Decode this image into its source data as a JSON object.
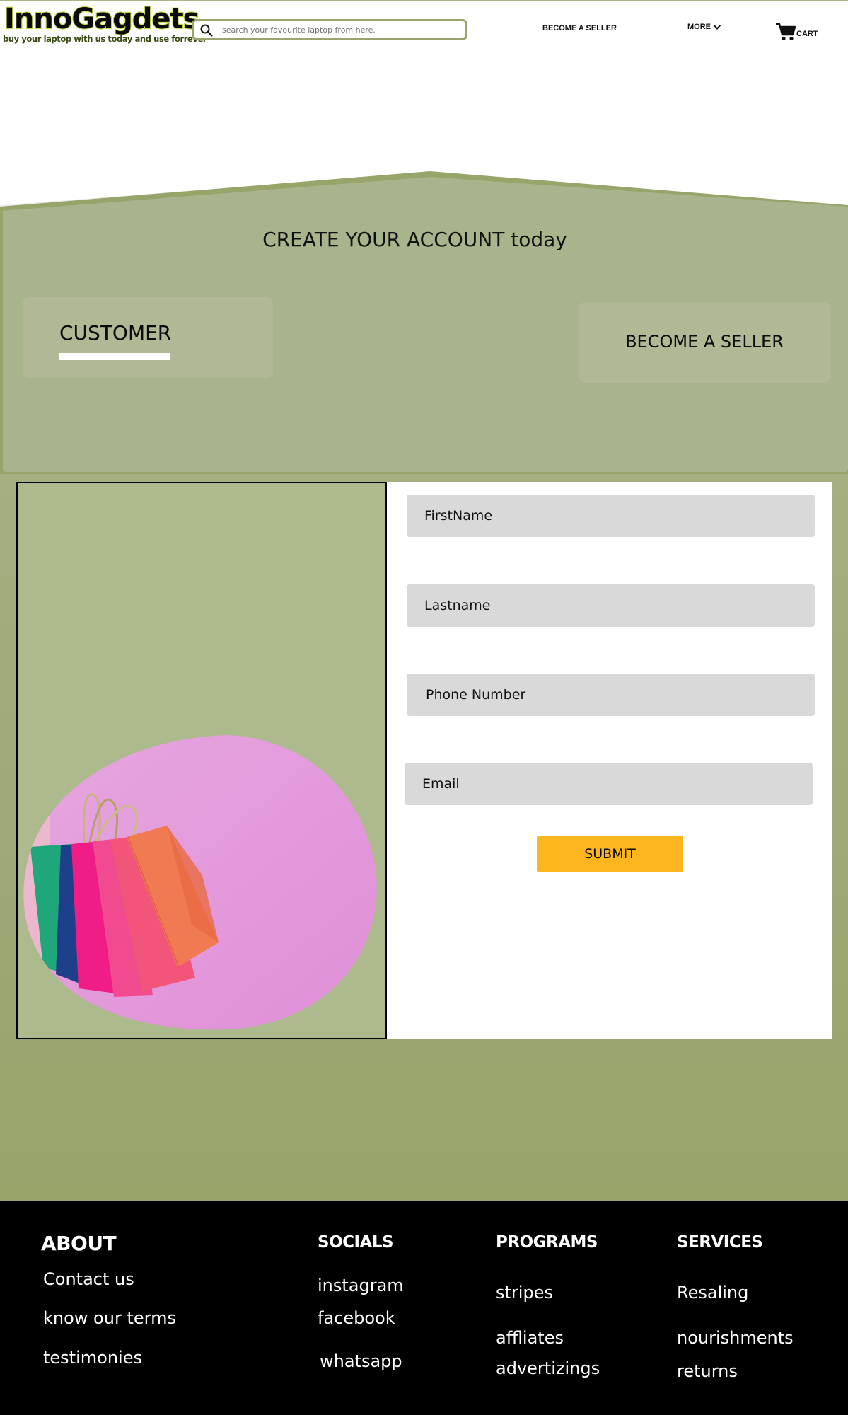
{
  "header": {
    "logo_text": "InnoGagdets",
    "logo_tagline": "buy your laptop with us  today and use forrever",
    "search_placeholder": "search your favourite laptop from here.",
    "nav_become_seller": "BECOME A SELLER",
    "nav_more": "MORE",
    "nav_cart": "CART"
  },
  "hero": {
    "title": "CREATE YOUR ACCOUNT today",
    "tabs": {
      "customer": "CUSTOMER",
      "seller": "BECOME A SELLER"
    }
  },
  "form": {
    "firstname_placeholder": "FirstName",
    "lastname_placeholder": "Lastname",
    "phone_placeholder": "Phone Number",
    "email_placeholder": "Email",
    "submit_label": "SUBMIT"
  },
  "footer": {
    "about": {
      "heading": "ABOUT",
      "links": [
        "Contact us",
        "know our terms",
        "testimonies"
      ]
    },
    "socials": {
      "heading": "SOCIALS",
      "links": [
        "instagram",
        "facebook",
        "whatsapp"
      ]
    },
    "programs": {
      "heading": "PROGRAMS",
      "links": [
        "stripes",
        "affliates",
        "advertizings"
      ]
    },
    "services": {
      "heading": "SERVICES",
      "links": [
        "Resaling",
        "nourishments",
        "returns"
      ]
    }
  },
  "colors": {
    "olive_header": "#a8b48b",
    "olive_band": "#97a46a",
    "panel_bg": "#adba8d",
    "tab_bg": "#b0b896",
    "field_bg": "#d9d9d9",
    "submit_bg": "#fbb51e",
    "blob_pink": "#e596dc",
    "footer_bg": "#000000"
  },
  "icons": {
    "search": "search-icon",
    "more": "chevron-down-icon",
    "cart": "cart-icon",
    "illustration": "shopping-bags-illustration"
  }
}
